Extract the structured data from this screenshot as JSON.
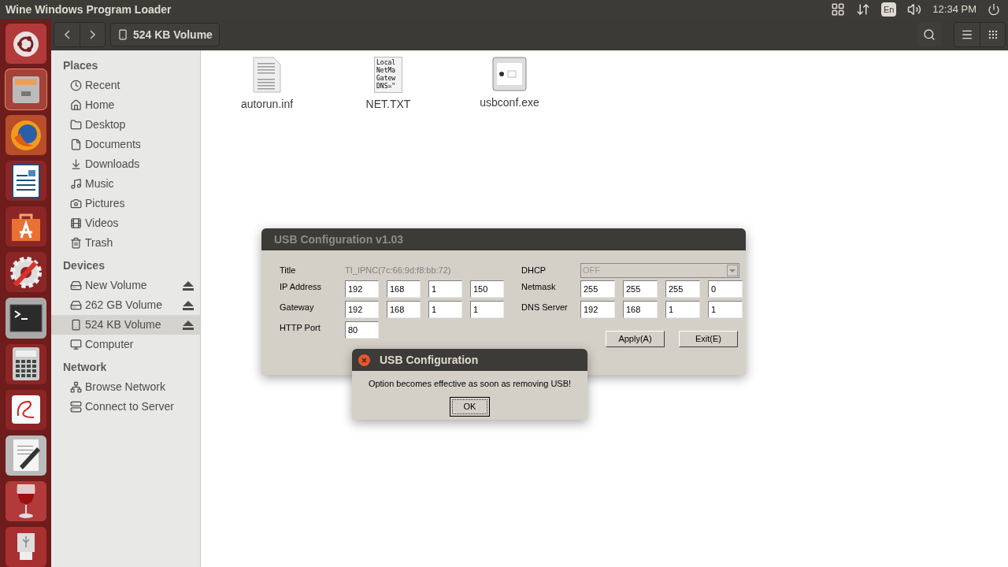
{
  "top_bar": {
    "title": "Wine Windows Program Loader",
    "keyboard": "En",
    "clock": "12:34 PM"
  },
  "file_manager": {
    "location": "524 KB Volume",
    "sidebar": [
      {
        "heading": "Places",
        "items": [
          {
            "label": "Recent",
            "selected": false
          },
          {
            "label": "Home",
            "selected": false
          },
          {
            "label": "Desktop",
            "selected": false
          },
          {
            "label": "Documents",
            "selected": false
          },
          {
            "label": "Downloads",
            "selected": false
          },
          {
            "label": "Music",
            "selected": false
          },
          {
            "label": "Pictures",
            "selected": false
          },
          {
            "label": "Videos",
            "selected": false
          },
          {
            "label": "Trash",
            "selected": false
          }
        ]
      },
      {
        "heading": "Devices",
        "items": [
          {
            "label": "New Volume",
            "selected": false,
            "eject": true
          },
          {
            "label": "262 GB Volume",
            "selected": false,
            "eject": true
          },
          {
            "label": "524 KB Volume",
            "selected": true,
            "eject": true
          },
          {
            "label": "Computer",
            "selected": false,
            "eject": false
          }
        ]
      },
      {
        "heading": "Network",
        "items": [
          {
            "label": "Browse Network",
            "selected": false
          },
          {
            "label": "Connect to Server",
            "selected": false
          }
        ]
      }
    ],
    "files": [
      {
        "name": "autorun.inf",
        "kind": "text"
      },
      {
        "name": "NET.TXT",
        "kind": "preview",
        "preview_lines": [
          "Local",
          "NetMa",
          "Gatew",
          "DNS=\""
        ]
      },
      {
        "name": "usbconf.exe",
        "kind": "program"
      }
    ]
  },
  "usb_dialog": {
    "title": "USB Configuration v1.03",
    "title_label": "Title",
    "title_value": "TI_IPNC(7c:66:9d:f8:bb:72)",
    "dhcp_label": "DHCP",
    "dhcp_value": "OFF",
    "dhcp_disabled": true,
    "left_rows": [
      {
        "label": "IP Address",
        "values": [
          "192",
          "168",
          "1",
          "150"
        ]
      },
      {
        "label": "Gateway",
        "values": [
          "192",
          "168",
          "1",
          "1"
        ]
      },
      {
        "label": "HTTP Port",
        "values": [
          "80"
        ]
      }
    ],
    "right_rows": [
      {
        "label": "Netmask",
        "values": [
          "255",
          "255",
          "255",
          "0"
        ]
      },
      {
        "label": "DNS Server",
        "values": [
          "192",
          "168",
          "1",
          "1"
        ]
      }
    ],
    "buttons": [
      "Apply(A)",
      "Exit(E)"
    ]
  },
  "message_box": {
    "title": "USB Configuration",
    "message": "Option becomes effective as soon as removing USB!",
    "button": "OK"
  }
}
